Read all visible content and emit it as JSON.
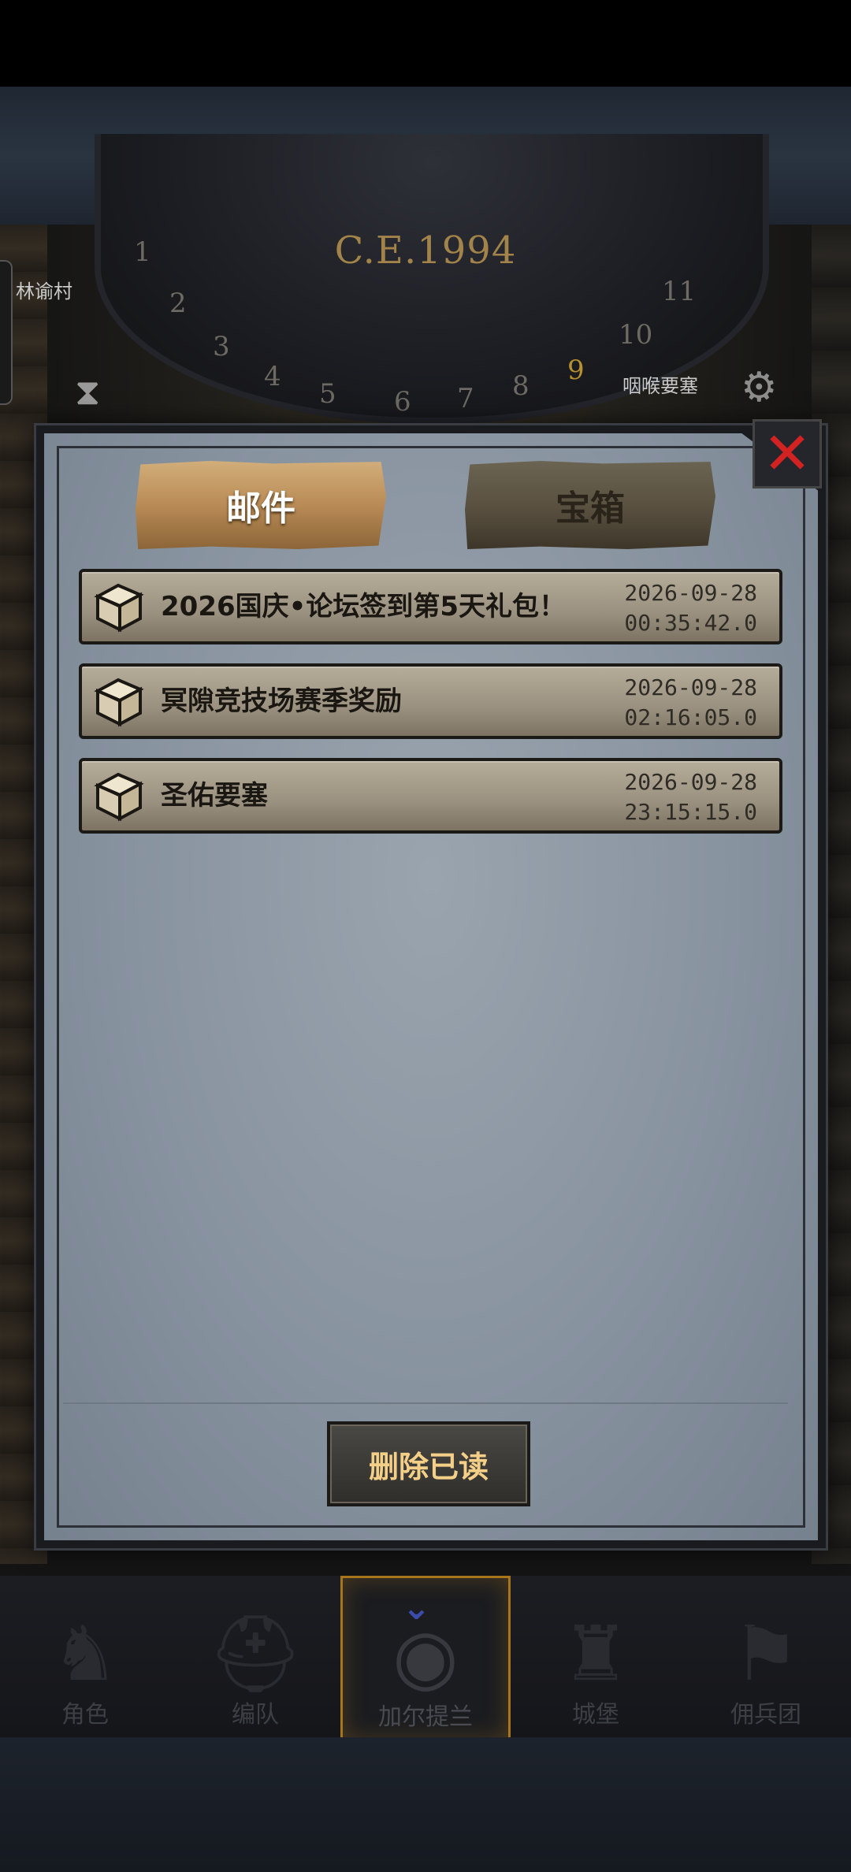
{
  "header": {
    "era": "C.E.1994",
    "wheel_numbers": [
      "1",
      "2",
      "3",
      "4",
      "5",
      "6",
      "7",
      "8",
      "9",
      "10",
      "11"
    ]
  },
  "map_labels": [
    "林谕村",
    "咽喉要塞"
  ],
  "tabs": [
    {
      "label": "邮件",
      "active": true
    },
    {
      "label": "宝箱",
      "active": false
    }
  ],
  "mails": [
    {
      "title": "2026国庆•论坛签到第5天礼包！",
      "date": "2026-09-28",
      "time": "00:35:42.0",
      "icon": "treasure-chest-icon"
    },
    {
      "title": "冥隙竞技场赛季奖励",
      "date": "2026-09-28",
      "time": "02:16:05.0",
      "icon": "treasure-chest-icon"
    },
    {
      "title": "圣佑要塞",
      "date": "2026-09-28",
      "time": "23:15:15.0",
      "icon": "treasure-chest-icon"
    }
  ],
  "delete_button": "删除已读",
  "close_button": {
    "icon": "close-icon",
    "color": "#d32222"
  },
  "nav": [
    {
      "label": "角色",
      "icon": "knight-icon"
    },
    {
      "label": "编队",
      "icon": "helmet-icon"
    },
    {
      "label": "加尔提兰",
      "icon": "world-globe-icon",
      "active": true
    },
    {
      "label": "城堡",
      "icon": "castle-icon"
    },
    {
      "label": "佣兵团",
      "icon": "mercenary-icon"
    }
  ],
  "colors": {
    "accent": "#a7761c",
    "tab_active": "#b98b56",
    "delete_text": "#f4cf88"
  }
}
